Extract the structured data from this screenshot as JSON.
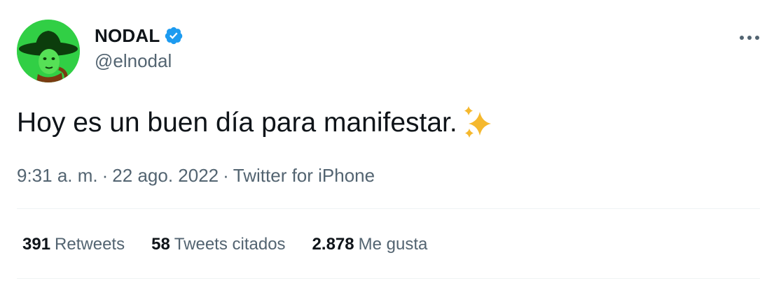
{
  "author": {
    "display_name": "NODAL",
    "handle": "@elnodal",
    "verified": true,
    "avatar_icon": "profile-avatar"
  },
  "tweet": {
    "text": "Hoy es un buen día para manifestar.",
    "emoji": "sparkles-emoji"
  },
  "meta": {
    "time": "9:31 a. m.",
    "separator": "·",
    "date": "22 ago. 2022",
    "source": "Twitter for iPhone"
  },
  "stats": [
    {
      "count": "391",
      "label": "Retweets"
    },
    {
      "count": "58",
      "label": "Tweets citados"
    },
    {
      "count": "2.878",
      "label": "Me gusta"
    }
  ],
  "colors": {
    "verified_badge": "#1d9bf0",
    "text_primary": "#0f1419",
    "text_secondary": "#536471",
    "divider": "#eff3f4",
    "avatar_bg": "#2ecc40",
    "sparkle": "#f5b82e"
  },
  "icons": {
    "more": "more-options-icon",
    "verified": "verified-badge-icon"
  }
}
